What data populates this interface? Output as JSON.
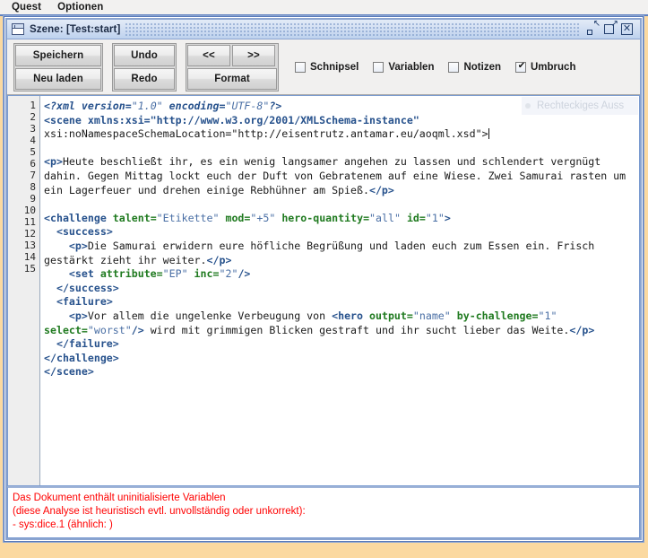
{
  "menubar": {
    "items": [
      {
        "label": "Quest"
      },
      {
        "label": "Optionen"
      }
    ]
  },
  "window": {
    "title": "Szene: [Test:start]",
    "icon": "window-icon",
    "controls": [
      {
        "name": "restore-button",
        "glyph": "restore-icon"
      },
      {
        "name": "maximize-button",
        "glyph": "maximize-icon"
      },
      {
        "name": "close-button",
        "glyph": "close-icon"
      }
    ]
  },
  "toolbar": {
    "save_label": "Speichern",
    "reload_label": "Neu laden",
    "undo_label": "Undo",
    "redo_label": "Redo",
    "prev_label": "<<",
    "next_label": ">>",
    "format_label": "Format",
    "checkboxes": [
      {
        "label": "Schnipsel",
        "checked": false
      },
      {
        "label": "Variablen",
        "checked": false
      },
      {
        "label": "Notizen",
        "checked": false
      },
      {
        "label": "Umbruch",
        "checked": true
      }
    ]
  },
  "ghost_tooltip": {
    "text": "Rechteckiges Auss"
  },
  "editor": {
    "line_numbers": [
      "1",
      "2",
      "",
      "3",
      "4",
      "",
      "",
      "5",
      "6",
      "7",
      "8",
      "",
      "9",
      "10",
      "11",
      "12",
      "",
      "",
      "13",
      "14",
      "15"
    ],
    "lines": [
      "<?xml version=\"1.0\" encoding=\"UTF-8\"?>",
      "<scene xmlns:xsi=\"http://www.w3.org/2001/XMLSchema-instance\"",
      "xsi:noNamespaceSchemaLocation=\"http://eisentrutz.antamar.eu/aoqml.xsd\">",
      "",
      "<p>Heute beschließt ihr, es ein wenig langsamer angehen zu lassen und schlendert vergnügt dahin. Gegen Mittag lockt euch der Duft von Gebratenem auf eine Wiese. Zwei Samurai rasten um ein Lagerfeuer und drehen einige Rebhühner am Spieß.</p>",
      "",
      "<challenge talent=\"Etikette\" mod=\"+5\" hero-quantity=\"all\" id=\"1\">",
      "  <success>",
      "    <p>Die Samurai erwidern eure höfliche Begrüßung und laden euch zum Essen ein. Frisch gestärkt zieht ihr weiter.</p>",
      "    <set attribute=\"EP\" inc=\"2\"/>",
      "  </success>",
      "  <failure>",
      "    <p>Vor allem die ungelenke Verbeugung von <hero output=\"name\" by-challenge=\"1\" select=\"worst\"/> wird mit grimmigen Blicken gestraft und ihr sucht lieber das Weite.</p>",
      "  </failure>",
      "</challenge>",
      "</scene>"
    ]
  },
  "messages": {
    "line1": "Das Dokument enthält uninitialisierte Variablen",
    "line2": "(diese Analyse ist heuristisch evtl. unvollständig oder unkorrekt):",
    "line3": "- sys:dice.1 (ähnlich: )",
    "color": "#ff0000"
  }
}
